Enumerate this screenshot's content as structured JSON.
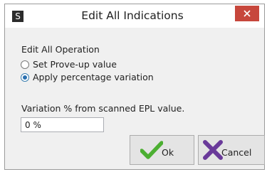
{
  "window": {
    "title": "Edit All Indications",
    "app_icon_letter": "S"
  },
  "operation": {
    "section_label": "Edit All Operation",
    "options": [
      {
        "label": "Set Prove-up value",
        "selected": false
      },
      {
        "label": "Apply percentage variation",
        "selected": true
      }
    ]
  },
  "variation": {
    "label": "Variation % from scanned EPL value.",
    "value": "0 %"
  },
  "buttons": {
    "ok_label": "Ok",
    "cancel_label": "Cancel"
  },
  "colors": {
    "close_button": "#c7473c",
    "ok_check": "#4caf32",
    "cancel_x": "#6a3a9a",
    "radio_selected": "#2a6fb0"
  },
  "icons": {
    "app": "app-icon",
    "close": "close-icon",
    "ok": "checkmark-icon",
    "cancel": "cancel-x-icon"
  }
}
